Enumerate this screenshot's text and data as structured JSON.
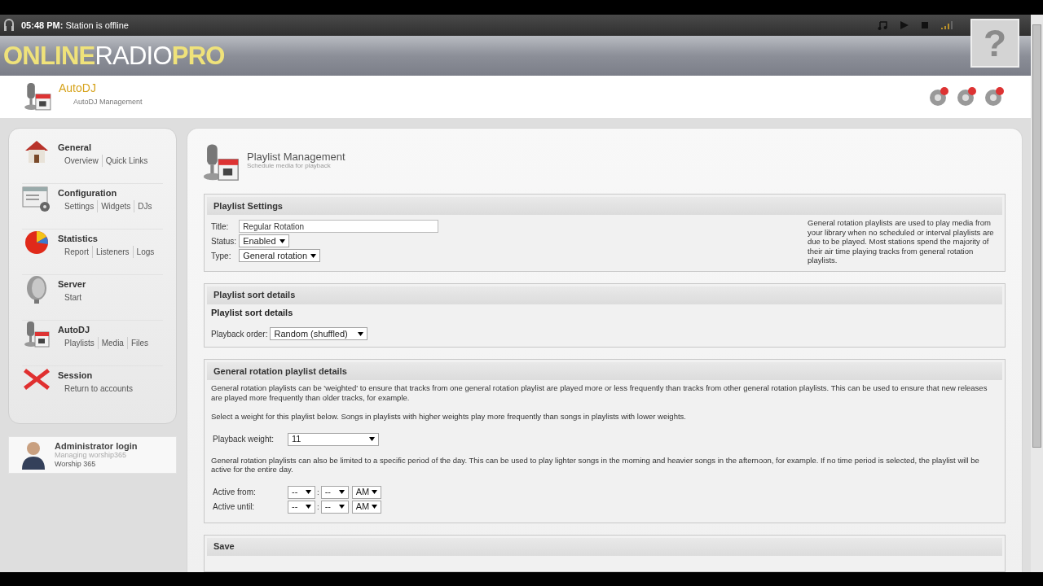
{
  "status_bar": {
    "time": "05:48 PM:",
    "message": "Station is offline"
  },
  "logo": {
    "part_1": "ONLINE",
    "part_2": "RADIO",
    "part_3": "PRO"
  },
  "help_button": {
    "label": "?"
  },
  "module": {
    "title": "AutoDJ",
    "subtitle": "AutoDJ Management"
  },
  "sidebar": {
    "items": [
      {
        "kind": "home",
        "title": "General",
        "links": [
          "Overview",
          "Quick Links"
        ]
      },
      {
        "kind": "config",
        "title": "Configuration",
        "links": [
          "Settings",
          "Widgets",
          "DJs"
        ]
      },
      {
        "kind": "stats",
        "title": "Statistics",
        "links": [
          "Report",
          "Listeners",
          "Logs"
        ]
      },
      {
        "kind": "server",
        "title": "Server",
        "links": [
          "Start"
        ]
      },
      {
        "kind": "autodj",
        "title": "AutoDJ",
        "links": [
          "Playlists",
          "Media",
          "Files"
        ]
      },
      {
        "kind": "session",
        "title": "Session",
        "links": [
          "Return to accounts"
        ]
      }
    ]
  },
  "login": {
    "title": "Administrator login",
    "line_1": "Managing worship365",
    "line_2": "Worship 365"
  },
  "page": {
    "title": "Playlist Management",
    "subtitle": "Schedule media for playback"
  },
  "playlist_settings": {
    "heading": "Playlist Settings",
    "title_label": "Title:",
    "title_value": "Regular Rotation",
    "status_label": "Status:",
    "status_value": "Enabled",
    "type_label": "Type:",
    "type_value": "General rotation",
    "help": "General rotation playlists are used to play media from your library when no scheduled or interval playlists are due to be played. Most stations spend the majority of their air time playing tracks from general rotation playlists."
  },
  "sort_details": {
    "heading": "Playlist sort details",
    "subheading": "Playlist sort details",
    "order_label": "Playback order:",
    "order_value": "Random (shuffled)"
  },
  "rotation_details": {
    "heading": "General rotation playlist details",
    "intro": "General rotation playlists can be 'weighted' to ensure that tracks from one general rotation playlist are played more or less frequently than tracks from other general rotation playlists. This can be used to ensure that new releases are played more frequently than older tracks, for example.",
    "weight_hint": "Select a weight for this playlist below. Songs in playlists with higher weights play more frequently than songs in playlists with lower weights.",
    "weight_label": "Playback weight:",
    "weight_value": "11",
    "time_hint": "General rotation playlists can also be limited to a specific period of the day. This can be used to play lighter songs in the morning and heavier songs in the afternoon, for example. If no time period is selected, the playlist will be active for the entire day.",
    "times": [
      {
        "label": "Active from:",
        "hour": "--",
        "separator": ":",
        "minute": "--",
        "period": "AM"
      },
      {
        "label": "Active until:",
        "hour": "--",
        "separator": ":",
        "minute": "--",
        "period": "AM"
      }
    ]
  },
  "save": {
    "heading": "Save"
  }
}
